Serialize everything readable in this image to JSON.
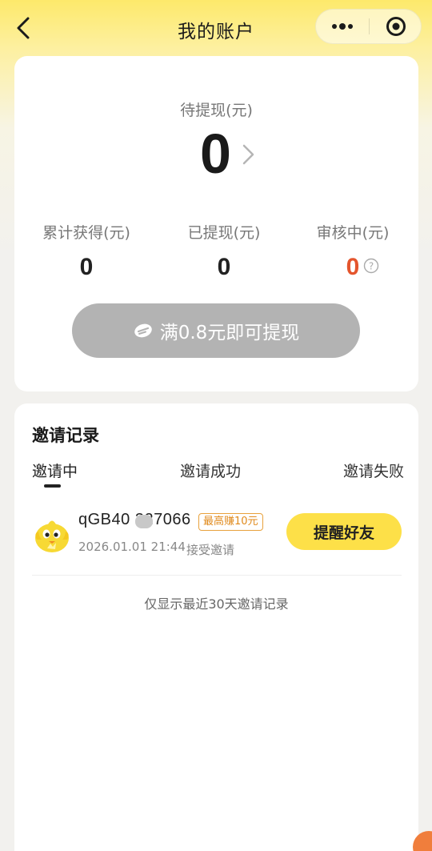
{
  "header": {
    "title": "我的账户"
  },
  "balance": {
    "pending_label": "待提现(元)",
    "pending_value": "0",
    "stats": [
      {
        "label": "累计获得(元)",
        "value": "0"
      },
      {
        "label": "已提现(元)",
        "value": "0"
      },
      {
        "label": "审核中(元)",
        "value": "0"
      }
    ],
    "withdraw_button": "满0.8元即可提现"
  },
  "records": {
    "title": "邀请记录",
    "tabs": [
      "邀请中",
      "邀请成功",
      "邀请失败"
    ],
    "active_tab": "邀请中",
    "items": [
      {
        "user_id": "qGB40 327066",
        "badge": "最高赚10元",
        "time": "2026.01.01 21:44",
        "status": "接受邀请",
        "action": "提醒好友"
      }
    ],
    "note": "仅显示最近30天邀请记录"
  },
  "colors": {
    "accent_yellow": "#fde048",
    "review_value_red": "#e4552d",
    "badge_orange": "#e08a1c",
    "disabled_button": "#b3b3b3"
  },
  "icons": [
    "back-icon",
    "more-dots-icon",
    "close-target-icon",
    "chevron-right-icon",
    "help-icon",
    "coin-icon",
    "chick-avatar-icon"
  ]
}
